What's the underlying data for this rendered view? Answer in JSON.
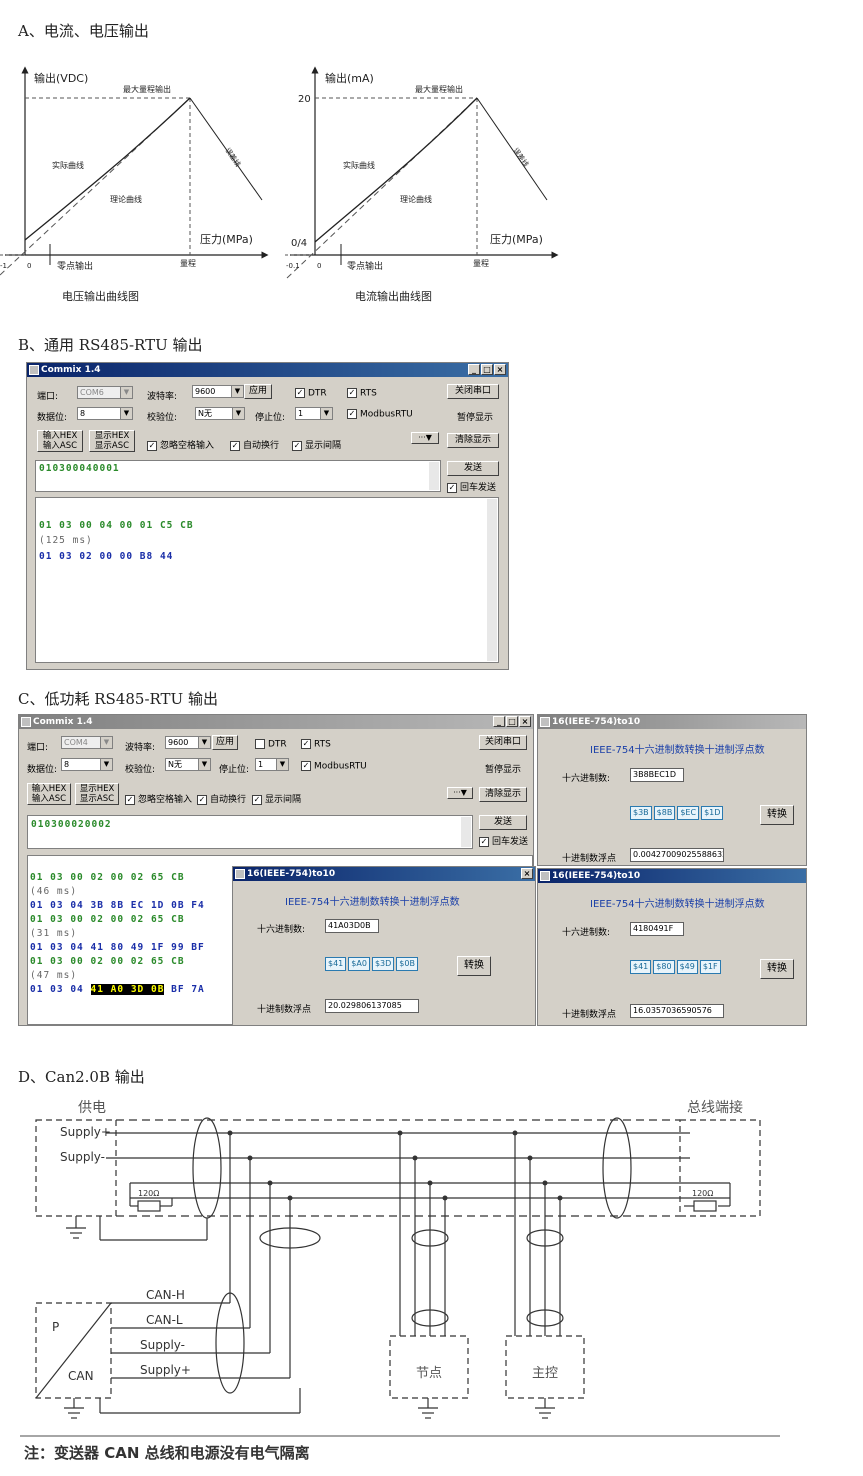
{
  "sections": {
    "a_title": "A、电流、电压输出",
    "b_title": "B、通用 RS485-RTU 输出",
    "c_title": "C、低功耗 RS485-RTU 输出",
    "d_title": "D、Can2.0B 输出"
  },
  "voltage_chart": {
    "ylabel": "输出(VDC)",
    "xlabel": "压力(MPa)",
    "max_label": "最大量程输出",
    "actual_label": "实际曲线",
    "theory_label": "理论曲线",
    "zero_label": "零点输出",
    "range_label": "量程",
    "overload_label": "误差线",
    "origin": "0",
    "neg": "-1",
    "caption": "电压输出曲线图"
  },
  "current_chart": {
    "ylabel": "输出(mA)",
    "xlabel": "压力(MPa)",
    "max_label": "最大量程输出",
    "actual_label": "实际曲线",
    "theory_label": "理论曲线",
    "zero_label": "零点输出",
    "range_label": "量程",
    "overload_label": "误差线",
    "y_top": "20",
    "y_low": "0/4",
    "origin": "0",
    "neg": "-0.1",
    "caption": "电流输出曲线图"
  },
  "commix": {
    "title": "Commix 1.4",
    "port_label": "端口:",
    "port_value": "COM6",
    "baud_label": "波特率:",
    "baud_value": "9600",
    "apply": "应用",
    "dtr": "DTR",
    "rts": "RTS",
    "close_port": "关闭串口",
    "data_label": "数据位:",
    "data_value": "8",
    "parity_label": "校验位:",
    "parity_value": "N无",
    "stop_label": "停止位:",
    "stop_value": "1",
    "modbus": "ModbusRTU",
    "pause": "暂停显示",
    "in_hex": "输入HEX",
    "in_asc": "输入ASC",
    "show_hex": "显示HEX",
    "show_asc": "显示ASC",
    "ignore_space": "忽略空格输入",
    "auto_wrap": "自动换行",
    "show_interval": "显示间隔",
    "more": "···▼",
    "clear": "清除显示",
    "send": "发送",
    "cr_send": "回车发送",
    "input": "010300040001",
    "out1": "01 03 00 04 00 01 C5 CB",
    "out2": "(125 ms)",
    "out3": "01 03 02 00 00 B8 44"
  },
  "commix2": {
    "title": "Commix 1.4",
    "port_value": "COM4",
    "input": "010300020002",
    "lines": [
      "01 03 00 02 00 02 65 CB",
      "(46 ms)",
      "01 03 04 3B 8B EC 1D 0B F4",
      "01 03 00 02 00 02 65 CB",
      "(31 ms)",
      "01 03 04 41 80 49 1F 99 BF",
      "01 03 00 02 00 02 65 CB",
      "(47 ms)"
    ],
    "last_a": "01 03 04",
    "last_hl": "41 A0 3D 0B",
    "last_b": "BF 7A"
  },
  "ieee": {
    "title": "16(IEEE-754)to10",
    "heading": "IEEE-754十六进制数转换十进制浮点数",
    "hex_label": "十六进制数:",
    "float_label": "十进制数浮点",
    "convert": "转换",
    "w1": {
      "hex": "3B8BEC1D",
      "bytes": [
        "$3B",
        "$8B",
        "$EC",
        "$1D"
      ],
      "float": "0.00427009025588632"
    },
    "w2": {
      "hex": "41A03D0B",
      "bytes": [
        "$41",
        "$A0",
        "$3D",
        "$0B"
      ],
      "float": "20.029806137085"
    },
    "w3": {
      "hex": "4180491F",
      "bytes": [
        "$41",
        "$80",
        "$49",
        "$1F"
      ],
      "float": "16.0357036590576"
    }
  },
  "can": {
    "power": "供电",
    "terminal": "总线端接",
    "supply_plus": "Supply+",
    "supply_minus": "Supply-",
    "r120": "120Ω",
    "can_h": "CAN-H",
    "can_l": "CAN-L",
    "p": "P",
    "can": "CAN",
    "node": "节点",
    "master": "主控",
    "note": "注：变送器 CAN 总线和电源没有电气隔离"
  },
  "colors": {
    "accent": "#1a3fa8",
    "green": "#2a8a2a",
    "blue_text": "#1a2ea8"
  }
}
